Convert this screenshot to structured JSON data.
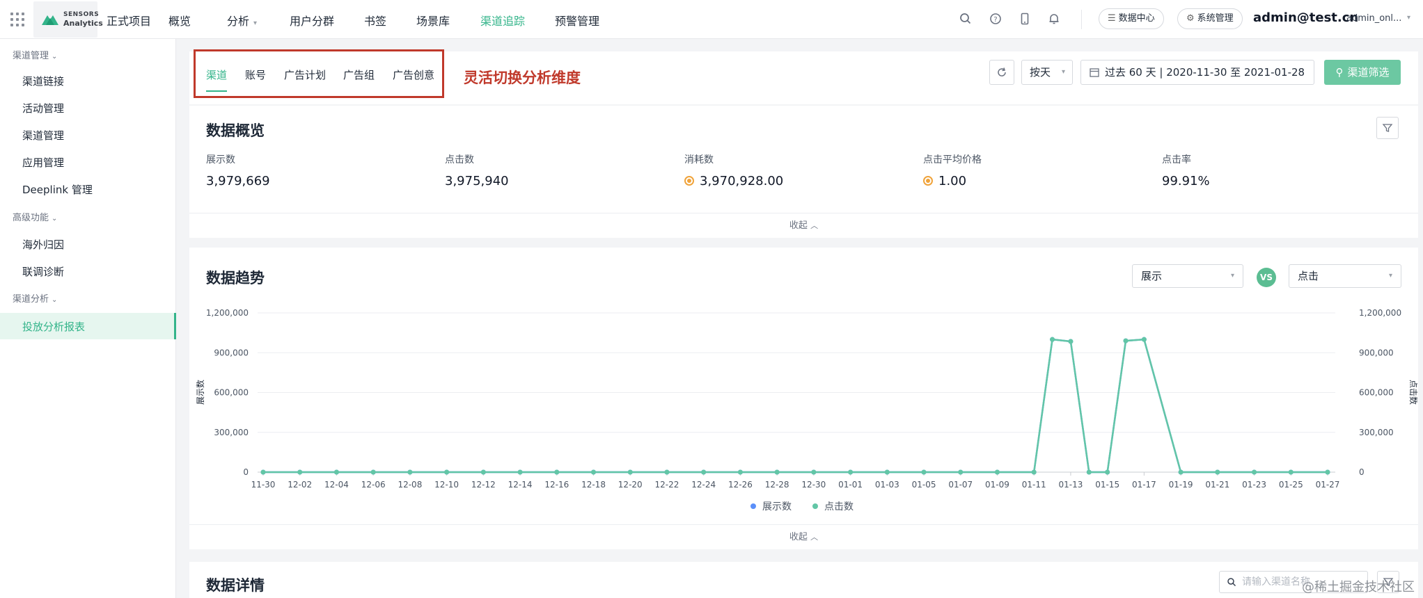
{
  "topnav": {
    "logo_line1": "SENSORS",
    "logo_line2": "Analytics",
    "project": "正式项目",
    "items": [
      "概览",
      "分析",
      "用户分群",
      "书签",
      "场景库",
      "渠道追踪",
      "预警管理"
    ],
    "active_item": "渠道追踪",
    "data_center": "数据中心",
    "system_admin": "系统管理",
    "account": "admin@test.cn",
    "account_sub": "admin_onl..."
  },
  "sidebar": {
    "group1": "渠道管理",
    "group1_items": [
      "渠道链接",
      "活动管理",
      "渠道管理",
      "应用管理",
      "Deeplink 管理"
    ],
    "group2": "高级功能",
    "group2_items": [
      "海外归因",
      "联调诊断"
    ],
    "group3": "渠道分析",
    "group3_items": [
      "投放分析报表"
    ]
  },
  "tabs": {
    "items": [
      "渠道",
      "账号",
      "广告计划",
      "广告组",
      "广告创意"
    ],
    "active": "渠道",
    "annotation": "灵活切换分析维度"
  },
  "controls": {
    "granularity": "按天",
    "date_range": "过去 60 天 | 2020-11-30 至 2021-01-28",
    "filter_button": "渠道筛选"
  },
  "overview": {
    "title": "数据概览",
    "metrics": [
      {
        "label": "展示数",
        "value": "3,979,669"
      },
      {
        "label": "点击数",
        "value": "3,975,940"
      },
      {
        "label": "消耗数",
        "value": "3,970,928.00"
      },
      {
        "label": "点击平均价格",
        "value": "1.00"
      },
      {
        "label": "点击率",
        "value": "99.91%"
      }
    ],
    "collapse": "收起"
  },
  "trend": {
    "title": "数据趋势",
    "left_select": "展示",
    "vs": "VS",
    "right_select": "点击",
    "collapse": "收起"
  },
  "details": {
    "title": "数据详情",
    "search_placeholder": "请输入渠道名称"
  },
  "watermark": "@稀土掘金技术社区",
  "colors": {
    "accent": "#33b48a",
    "series_impressions": "#5b8ff9",
    "series_clicks": "#62c6a6",
    "annotation": "#c0392b"
  },
  "chart_data": {
    "type": "line",
    "title": "",
    "ylabel": "展示数",
    "y2label": "点击数",
    "ylim": [
      0,
      1200000
    ],
    "y_ticks": [
      "0",
      "300,000",
      "600,000",
      "900,000",
      "1,200,000"
    ],
    "x_tick_labels": [
      "11-30",
      "12-02",
      "12-04",
      "12-06",
      "12-08",
      "12-10",
      "12-12",
      "12-14",
      "12-16",
      "12-18",
      "12-20",
      "12-22",
      "12-24",
      "12-26",
      "12-28",
      "12-30",
      "01-01",
      "01-03",
      "01-05",
      "01-07",
      "01-09",
      "01-11",
      "01-13",
      "01-15",
      "01-17",
      "01-19",
      "01-21",
      "01-23",
      "01-25",
      "01-27"
    ],
    "x": [
      "11-30",
      "12-02",
      "12-04",
      "12-06",
      "12-08",
      "12-10",
      "12-12",
      "12-14",
      "12-16",
      "12-18",
      "12-20",
      "12-22",
      "12-24",
      "12-26",
      "12-28",
      "12-30",
      "01-01",
      "01-03",
      "01-05",
      "01-07",
      "01-09",
      "01-11",
      "01-12",
      "01-13",
      "01-14",
      "01-15",
      "01-16",
      "01-17",
      "01-19",
      "01-21",
      "01-23",
      "01-25",
      "01-27"
    ],
    "series": [
      {
        "name": "展示数",
        "values": [
          0,
          0,
          0,
          0,
          0,
          0,
          0,
          0,
          0,
          0,
          0,
          0,
          0,
          0,
          0,
          0,
          0,
          0,
          0,
          0,
          0,
          0,
          1000000,
          985000,
          0,
          0,
          990000,
          1000000,
          0,
          0,
          0,
          0,
          0
        ]
      },
      {
        "name": "点击数",
        "values": [
          0,
          0,
          0,
          0,
          0,
          0,
          0,
          0,
          0,
          0,
          0,
          0,
          0,
          0,
          0,
          0,
          0,
          0,
          0,
          0,
          0,
          0,
          1000000,
          985000,
          0,
          0,
          990000,
          1000000,
          0,
          0,
          0,
          0,
          0
        ]
      }
    ],
    "legend": "bottom-center",
    "grid": true
  }
}
